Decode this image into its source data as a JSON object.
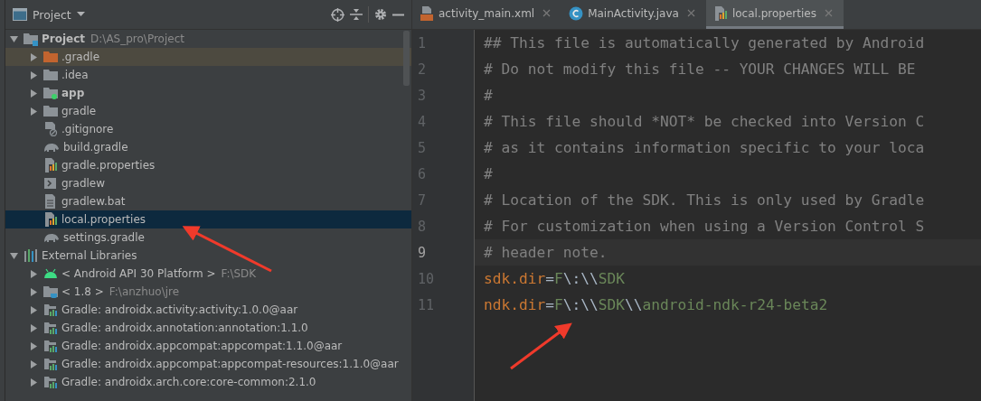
{
  "project_panel": {
    "title": "Project",
    "tree": [
      {
        "label": "Project",
        "detail": "D:\\AS_pro\\Project",
        "kind": "project",
        "bold": true,
        "expanded": true,
        "selected": false,
        "highlighted": false,
        "children": [
          {
            "label": ".gradle",
            "kind": "excluded-folder",
            "bold": false,
            "expanded": false,
            "selected": false,
            "highlighted": true
          },
          {
            "label": ".idea",
            "kind": "folder",
            "bold": false,
            "expanded": false,
            "selected": false,
            "highlighted": false
          },
          {
            "label": "app",
            "kind": "module",
            "bold": true,
            "expanded": false,
            "selected": false,
            "highlighted": false
          },
          {
            "label": "gradle",
            "kind": "folder",
            "bold": false,
            "expanded": false,
            "selected": false,
            "highlighted": false
          },
          {
            "label": ".gitignore",
            "kind": "ignore-file",
            "bold": false,
            "selected": false,
            "highlighted": false
          },
          {
            "label": "build.gradle",
            "kind": "gradle-script",
            "bold": false,
            "selected": false,
            "highlighted": false
          },
          {
            "label": "gradle.properties",
            "kind": "properties",
            "bold": false,
            "selected": false,
            "highlighted": false
          },
          {
            "label": "gradlew",
            "kind": "shell-script",
            "bold": false,
            "selected": false,
            "highlighted": false
          },
          {
            "label": "gradlew.bat",
            "kind": "text-file",
            "bold": false,
            "selected": false,
            "highlighted": false
          },
          {
            "label": "local.properties",
            "kind": "properties",
            "bold": false,
            "selected": true,
            "highlighted": false
          },
          {
            "label": "settings.gradle",
            "kind": "gradle-script",
            "bold": false,
            "selected": false,
            "highlighted": false
          }
        ]
      },
      {
        "label": "External Libraries",
        "kind": "libraries",
        "bold": false,
        "expanded": true,
        "selected": false,
        "highlighted": false,
        "children": [
          {
            "label": "< Android API 30 Platform >",
            "detail": "F:\\SDK",
            "kind": "android-sdk",
            "bold": false,
            "expanded": false,
            "selected": false,
            "highlighted": false
          },
          {
            "label": "< 1.8 >",
            "detail": "F:\\anzhuo\\jre",
            "kind": "jdk",
            "bold": false,
            "expanded": false,
            "selected": false,
            "highlighted": false
          },
          {
            "label": "Gradle: androidx.activity:activity:1.0.0@aar",
            "kind": "library",
            "bold": false,
            "expanded": false,
            "selected": false,
            "highlighted": false
          },
          {
            "label": "Gradle: androidx.annotation:annotation:1.1.0",
            "kind": "library",
            "bold": false,
            "expanded": false,
            "selected": false,
            "highlighted": false
          },
          {
            "label": "Gradle: androidx.appcompat:appcompat:1.1.0@aar",
            "kind": "library",
            "bold": false,
            "expanded": false,
            "selected": false,
            "highlighted": false
          },
          {
            "label": "Gradle: androidx.appcompat:appcompat-resources:1.1.0@aar",
            "kind": "library",
            "bold": false,
            "expanded": false,
            "selected": false,
            "highlighted": false
          },
          {
            "label": "Gradle: androidx.arch.core:core-common:2.1.0",
            "kind": "library",
            "bold": false,
            "expanded": false,
            "selected": false,
            "highlighted": false
          }
        ]
      }
    ]
  },
  "editor": {
    "tabs": [
      {
        "label": "activity_main.xml",
        "kind": "xml",
        "selected": false
      },
      {
        "label": "MainActivity.java",
        "kind": "java",
        "selected": false
      },
      {
        "label": "local.properties",
        "kind": "properties",
        "selected": true
      }
    ],
    "lines": [
      {
        "number": "1",
        "current": false,
        "tokens": [
          {
            "kind": "comment",
            "text": "## This file is automatically generated by Android"
          }
        ]
      },
      {
        "number": "2",
        "current": false,
        "tokens": [
          {
            "kind": "comment",
            "text": "# Do not modify this file -- YOUR CHANGES WILL BE"
          }
        ]
      },
      {
        "number": "3",
        "current": false,
        "tokens": [
          {
            "kind": "comment",
            "text": "#"
          }
        ]
      },
      {
        "number": "4",
        "current": false,
        "tokens": [
          {
            "kind": "comment",
            "text": "# This file should *NOT* be checked into Version C"
          }
        ]
      },
      {
        "number": "5",
        "current": false,
        "tokens": [
          {
            "kind": "comment",
            "text": "# as it contains information specific to your loca"
          }
        ]
      },
      {
        "number": "6",
        "current": false,
        "tokens": [
          {
            "kind": "comment",
            "text": "#"
          }
        ]
      },
      {
        "number": "7",
        "current": false,
        "tokens": [
          {
            "kind": "comment",
            "text": "# Location of the SDK. This is only used by Gradle"
          }
        ]
      },
      {
        "number": "8",
        "current": false,
        "tokens": [
          {
            "kind": "comment",
            "text": "# For customization when using a Version Control S"
          }
        ]
      },
      {
        "number": "9",
        "current": true,
        "tokens": [
          {
            "kind": "comment",
            "text": "# header note."
          }
        ]
      },
      {
        "number": "10",
        "current": false,
        "tokens": [
          {
            "kind": "key",
            "text": "sdk.dir"
          },
          {
            "kind": "sep",
            "text": "="
          },
          {
            "kind": "value",
            "text": "F"
          },
          {
            "kind": "escape",
            "text": "\\:\\\\"
          },
          {
            "kind": "value",
            "text": "SDK"
          }
        ]
      },
      {
        "number": "11",
        "current": false,
        "tokens": [
          {
            "kind": "key",
            "text": "ndk.dir"
          },
          {
            "kind": "sep",
            "text": "="
          },
          {
            "kind": "value",
            "text": "F"
          },
          {
            "kind": "escape",
            "text": "\\:\\\\"
          },
          {
            "kind": "value",
            "text": "SDK"
          },
          {
            "kind": "escape",
            "text": "\\\\"
          },
          {
            "kind": "value",
            "text": "android-ndk-r24-beta2"
          }
        ]
      }
    ]
  }
}
